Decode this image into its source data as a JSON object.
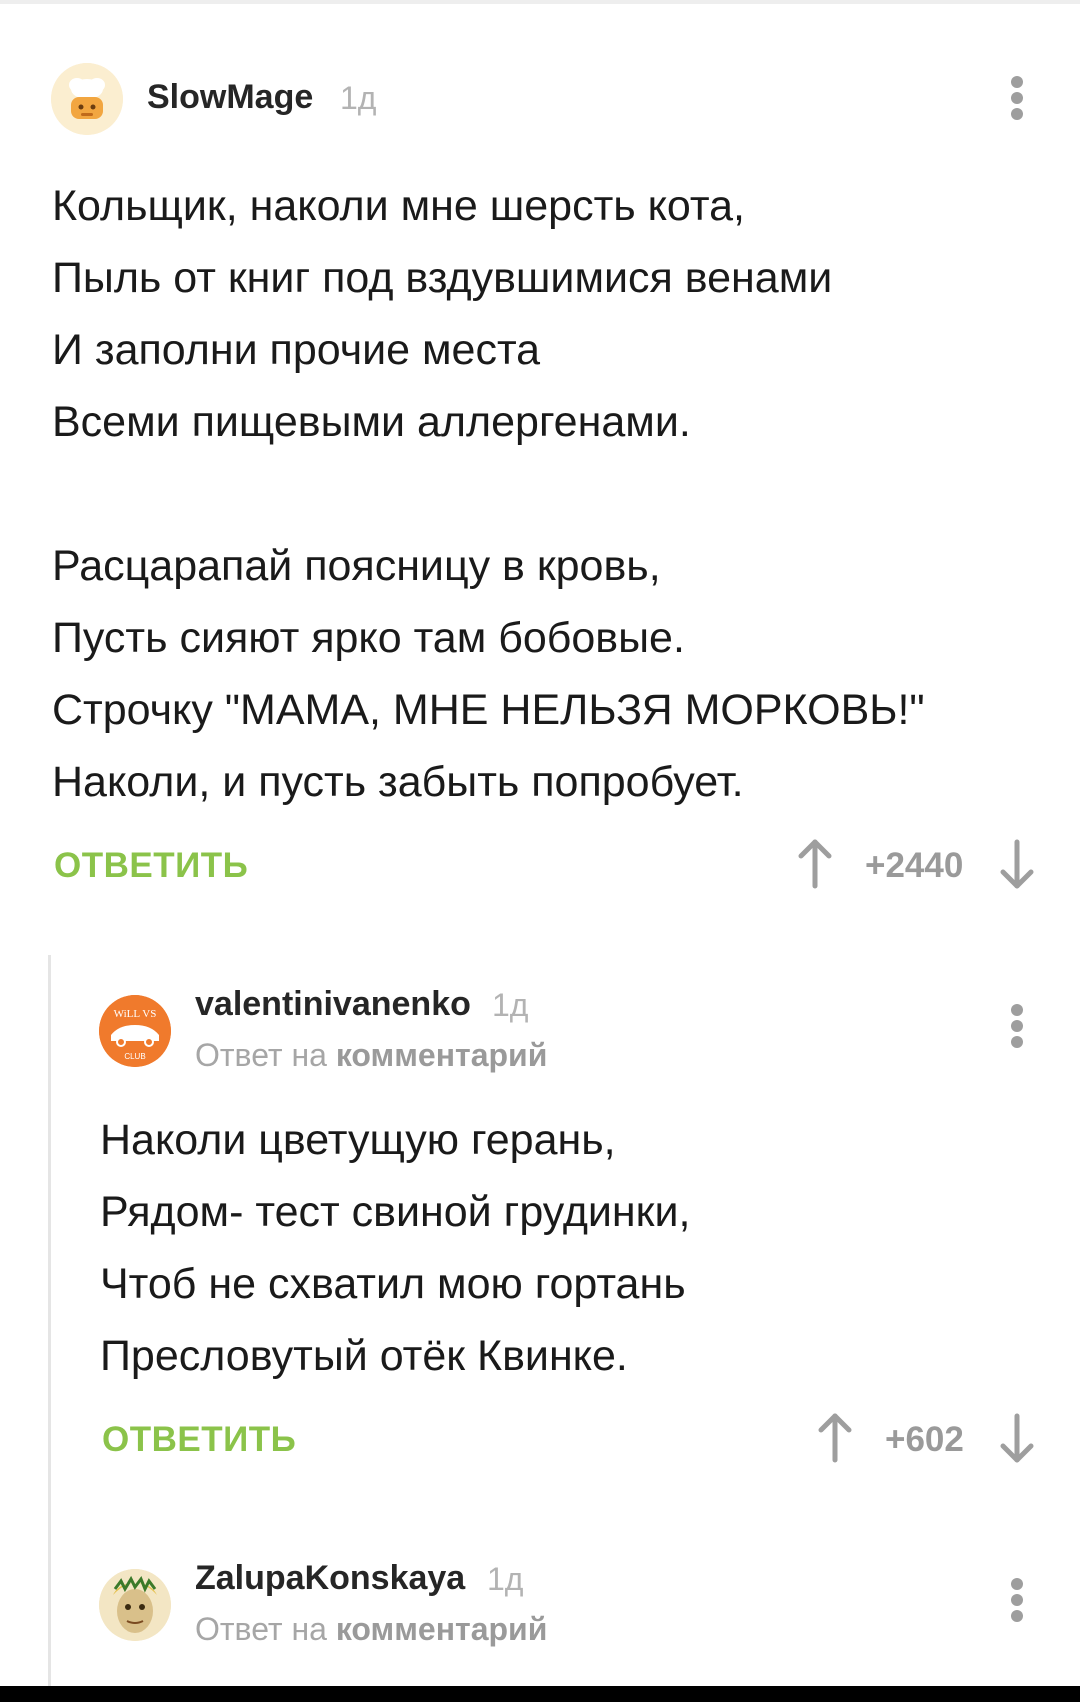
{
  "comments": [
    {
      "author": "SlowMage",
      "time": "1д",
      "avatar_icon": "chef-hat-avatar",
      "lines": [
        "Кольщик, наколи мне шерсть кота,",
        "Пыль от книг под вздувшимися венами",
        "И заполни прочие места",
        "Всеми пищевыми аллергенами.",
        "",
        "Расцарапай поясницу в кровь,",
        "Пусть сияют ярко там бобовые.",
        "Строчку \"МАМА, МНЕ НЕЛЬЗЯ МОРКОВЬ!\"",
        "Наколи, и пусть забыть попробует."
      ],
      "reply_label": "ОТВЕТИТЬ",
      "score": "+2440"
    },
    {
      "author": "valentinivanenko",
      "time": "1д",
      "avatar_icon": "car-club-logo-avatar",
      "avatar_text": "WiLL VS",
      "avatar_subtext": "CLUB",
      "reply_prefix": "Ответ на",
      "reply_target": "комментарий",
      "lines": [
        "Наколи цветущую герань,",
        "Рядом- тест свиной грудинки,",
        "Чтоб не схватил мою гортань",
        "Пресловутый отёк Квинке."
      ],
      "reply_label": "ОТВЕТИТЬ",
      "score": "+602"
    },
    {
      "author": "ZalupaKonskaya",
      "time": "1д",
      "avatar_icon": "cartoon-face-avatar",
      "reply_prefix": "Ответ на",
      "reply_target": "комментарий"
    }
  ],
  "colors": {
    "accent_green": "#8bc34a",
    "muted_text": "#a6a6a6",
    "icon_gray": "#9e9e9e"
  }
}
